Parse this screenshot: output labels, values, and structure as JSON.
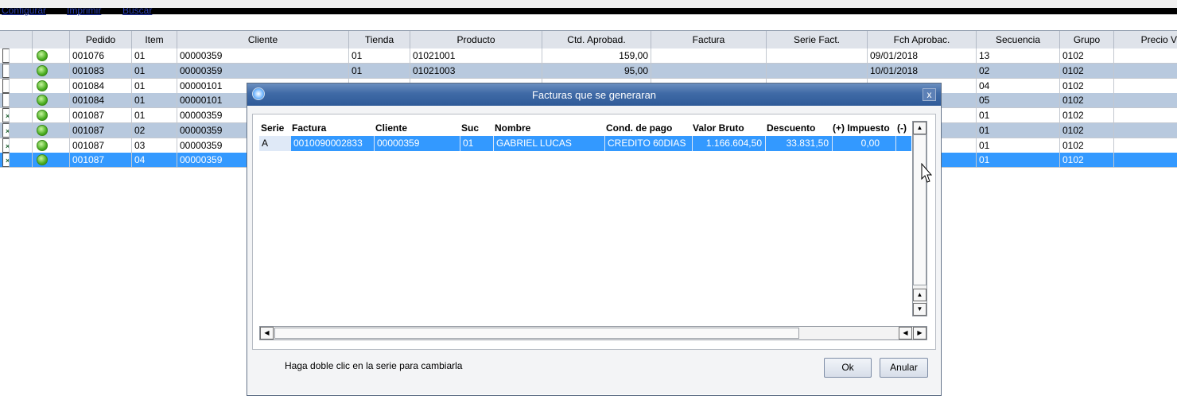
{
  "toolbar": {
    "links": [
      "Configurar",
      "Imprimir",
      "Buscar"
    ]
  },
  "grid": {
    "columns": [
      "",
      "",
      "Pedido",
      "Item",
      "Cliente",
      "Tienda",
      "Producto",
      "Ctd. Aprobad.",
      "Factura",
      "Serie Fact.",
      "Fch Aprobac.",
      "Secuencia",
      "Grupo",
      "Precio V"
    ],
    "rows": [
      {
        "checked": false,
        "pedido": "001076",
        "item": "01",
        "cliente": "00000359",
        "tienda": "01",
        "producto": "01021001",
        "ctd": "159,00",
        "factura": "",
        "serie": "",
        "fecha": "09/01/2018",
        "secuencia": "13",
        "grupo": "0102"
      },
      {
        "checked": false,
        "pedido": "001083",
        "item": "01",
        "cliente": "00000359",
        "tienda": "01",
        "producto": "01021003",
        "ctd": "95,00",
        "factura": "",
        "serie": "",
        "fecha": "10/01/2018",
        "secuencia": "02",
        "grupo": "0102"
      },
      {
        "checked": false,
        "pedido": "001084",
        "item": "01",
        "cliente": "00000101",
        "tienda": "",
        "producto": "",
        "ctd": "",
        "factura": "",
        "serie": "",
        "fecha": "",
        "secuencia": "04",
        "grupo": "0102"
      },
      {
        "checked": false,
        "pedido": "001084",
        "item": "01",
        "cliente": "00000101",
        "tienda": "",
        "producto": "",
        "ctd": "",
        "factura": "",
        "serie": "",
        "fecha": "",
        "secuencia": "05",
        "grupo": "0102"
      },
      {
        "checked": true,
        "pedido": "001087",
        "item": "01",
        "cliente": "00000359",
        "tienda": "",
        "producto": "",
        "ctd": "",
        "factura": "",
        "serie": "",
        "fecha": "",
        "secuencia": "01",
        "grupo": "0102"
      },
      {
        "checked": true,
        "pedido": "001087",
        "item": "02",
        "cliente": "00000359",
        "tienda": "",
        "producto": "",
        "ctd": "",
        "factura": "",
        "serie": "",
        "fecha": "",
        "secuencia": "01",
        "grupo": "0102"
      },
      {
        "checked": true,
        "pedido": "001087",
        "item": "03",
        "cliente": "00000359",
        "tienda": "",
        "producto": "",
        "ctd": "",
        "factura": "",
        "serie": "",
        "fecha": "",
        "secuencia": "01",
        "grupo": "0102"
      },
      {
        "checked": true,
        "pedido": "001087",
        "item": "04",
        "cliente": "00000359",
        "tienda": "",
        "producto": "",
        "ctd": "",
        "factura": "",
        "serie": "",
        "fecha": "",
        "secuencia": "01",
        "grupo": "0102"
      }
    ]
  },
  "dialog": {
    "title": "Facturas que se generaran",
    "close_label": "x",
    "columns": [
      "Serie",
      "Factura",
      "Cliente",
      "Suc",
      "Nombre",
      "Cond. de pago",
      "Valor Bruto",
      "Descuento",
      "(+) Impuesto",
      "(-)"
    ],
    "row": {
      "serie": "A",
      "factura": "0010090002833",
      "cliente": "00000359",
      "suc": "01",
      "nombre": "GABRIEL LUCAS",
      "cond": "CREDITO 60DIAS",
      "bruto": "1.166.604,50",
      "descuento": "33.831,50",
      "impuesto": "0,00"
    },
    "hint": "Haga doble clic en la serie para cambiarla",
    "ok_label": "Ok",
    "cancel_label": "Anular"
  },
  "colors": {
    "selected": "#3399ff",
    "alt_row": "#b8c9de",
    "title_bar": "#3f6aa6"
  }
}
